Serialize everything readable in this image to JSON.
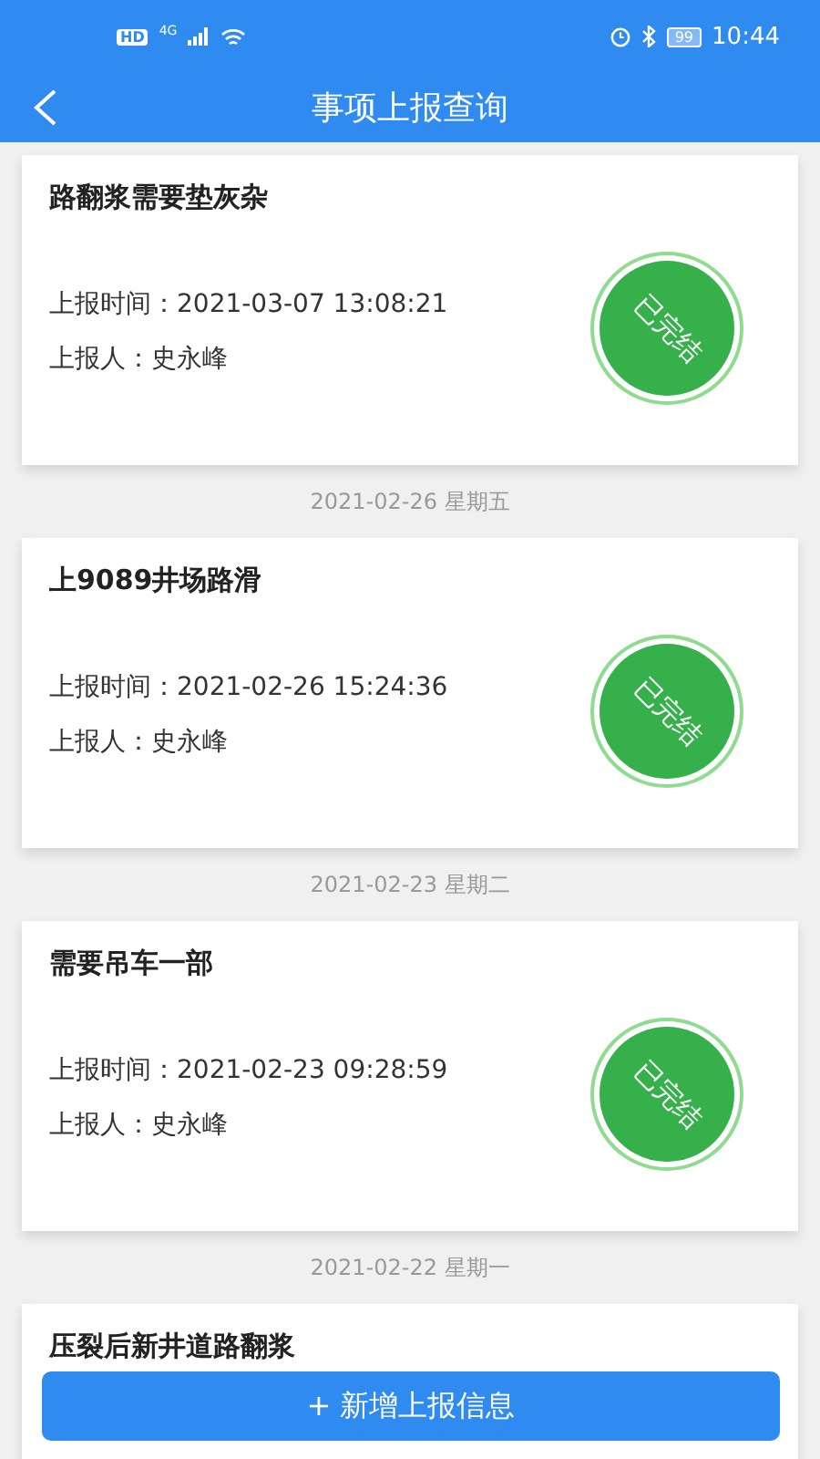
{
  "status_bar": {
    "hd": "HD",
    "network": "4G",
    "battery": "99",
    "time": "10:44"
  },
  "header": {
    "title": "事项上报查询"
  },
  "reports": [
    {
      "title": "路翻浆需要垫灰杂",
      "time_label": "上报时间：",
      "time": "2021-03-07 13:08:21",
      "reporter_label": "上报人：",
      "reporter": "史永峰",
      "stamp": "已完结"
    },
    {
      "date": "2021-02-26 星期五",
      "title": "上9089井场路滑",
      "time_label": "上报时间：",
      "time": "2021-02-26 15:24:36",
      "reporter_label": "上报人：",
      "reporter": "史永峰",
      "stamp": "已完结"
    },
    {
      "date": "2021-02-23 星期二",
      "title": "需要吊车一部",
      "time_label": "上报时间：",
      "time": "2021-02-23 09:28:59",
      "reporter_label": "上报人：",
      "reporter": "史永峰",
      "stamp": "已完结"
    },
    {
      "date": "2021-02-22 星期一",
      "title": "压裂后新井道路翻浆"
    }
  ],
  "add_button": "+ 新增上报信息"
}
